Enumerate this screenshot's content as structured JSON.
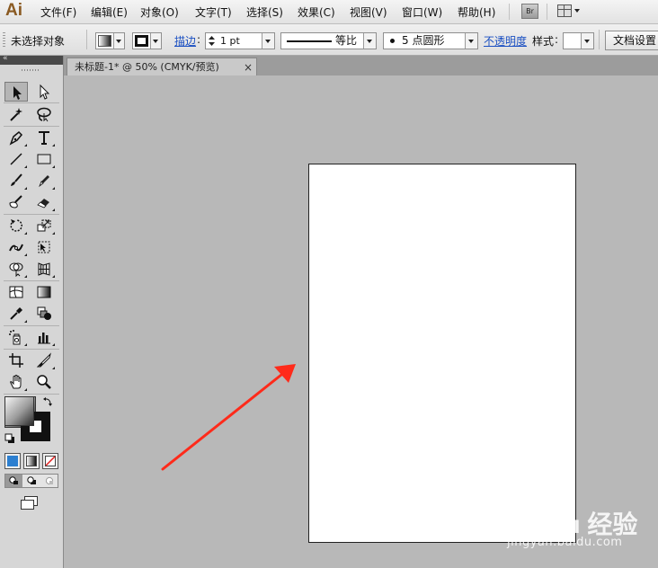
{
  "app": {
    "logo": "Ai"
  },
  "menu": {
    "items": [
      "文件(F)",
      "编辑(E)",
      "对象(O)",
      "文字(T)",
      "选择(S)",
      "效果(C)",
      "视图(V)",
      "窗口(W)",
      "帮助(H)"
    ],
    "bridge_badge": "Br",
    "arrange_icon": "arrange-documents-icon"
  },
  "control_bar": {
    "selection_status": "未选择对象",
    "fill_icon": "gradient-swatch-icon",
    "stroke_icon": "stroke-swatch-icon",
    "stroke_label": "描边",
    "stroke_weight": "1 pt",
    "profile_label": "等比",
    "brush_label": "5 点圆形",
    "opacity_label": "不透明度",
    "style_label": "样式",
    "doc_setup_label": "文档设置"
  },
  "document": {
    "tab_title": "未标题-1* @ 50% (CMYK/预览)",
    "close_symbol": "×"
  },
  "tools": {
    "collapse_symbol": "«",
    "icons": [
      "selection-tool-icon",
      "direct-selection-tool-icon",
      "magic-wand-tool-icon",
      "lasso-tool-icon",
      "pen-tool-icon",
      "type-tool-icon",
      "line-tool-icon",
      "rectangle-tool-icon",
      "paintbrush-tool-icon",
      "pencil-tool-icon",
      "blob-brush-tool-icon",
      "eraser-tool-icon",
      "rotate-tool-icon",
      "scale-tool-icon",
      "width-tool-icon",
      "free-transform-tool-icon",
      "shape-builder-tool-icon",
      "perspective-grid-tool-icon",
      "mesh-tool-icon",
      "gradient-tool-icon",
      "eyedropper-tool-icon",
      "blend-tool-icon",
      "symbol-sprayer-tool-icon",
      "column-graph-tool-icon",
      "artboard-tool-icon",
      "slice-tool-icon",
      "hand-tool-icon",
      "zoom-tool-icon"
    ]
  },
  "colors": {
    "annotation_arrow": "#ff2a1a",
    "logo": "#8a5a22",
    "link": "#1a4fc2",
    "canvas": "#b8b8b8"
  },
  "watermark": {
    "brand": "Bai du 经验",
    "url": "jingyan.baidu.com"
  }
}
